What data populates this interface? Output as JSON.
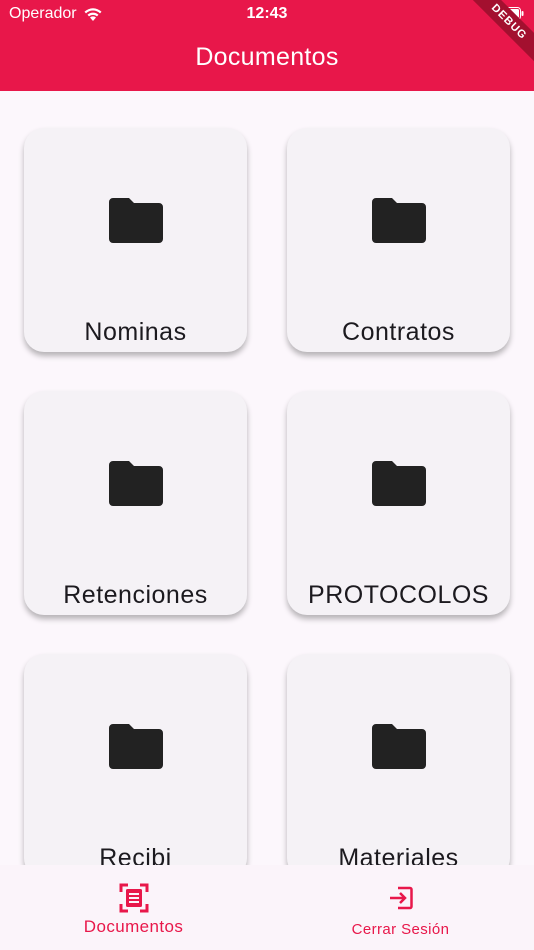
{
  "status_bar": {
    "carrier": "Operador",
    "time": "12:43"
  },
  "app_bar": {
    "title": "Documentos",
    "debug_banner": "DEBUG"
  },
  "folders": [
    {
      "label": "Nominas"
    },
    {
      "label": "Contratos"
    },
    {
      "label": "Retenciones"
    },
    {
      "label": "PROTOCOLOS"
    },
    {
      "label": "Recibi"
    },
    {
      "label": "Materiales"
    }
  ],
  "bottom_nav": {
    "documents_label": "Documentos",
    "logout_label": "Cerrar Sesión"
  },
  "colors": {
    "accent": "#e8174a",
    "card": "#f5f2f6",
    "icon": "#222222"
  }
}
